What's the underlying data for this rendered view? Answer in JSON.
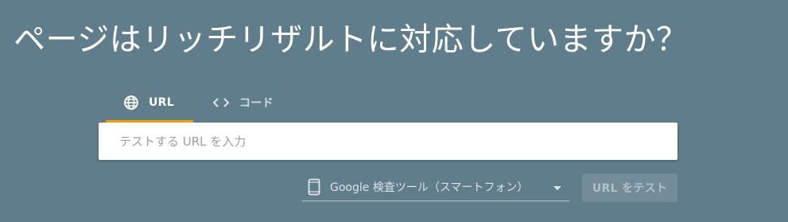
{
  "header": {
    "title": "ページはリッチリザルトに対応していますか？"
  },
  "tabs": [
    {
      "label": "URL",
      "icon": "globe-icon",
      "active": true
    },
    {
      "label": "コード",
      "icon": "code-icon",
      "active": false
    }
  ],
  "url_field": {
    "placeholder": "テストする URL を入力",
    "value": ""
  },
  "device_select": {
    "icon": "smartphone-icon",
    "selected": "Google 検査ツール（スマートフォン）"
  },
  "test_button": {
    "label": "URL をテスト"
  },
  "colors": {
    "background": "#607d8b",
    "tab_indicator": "#f4a300",
    "input_background": "#ffffff"
  }
}
